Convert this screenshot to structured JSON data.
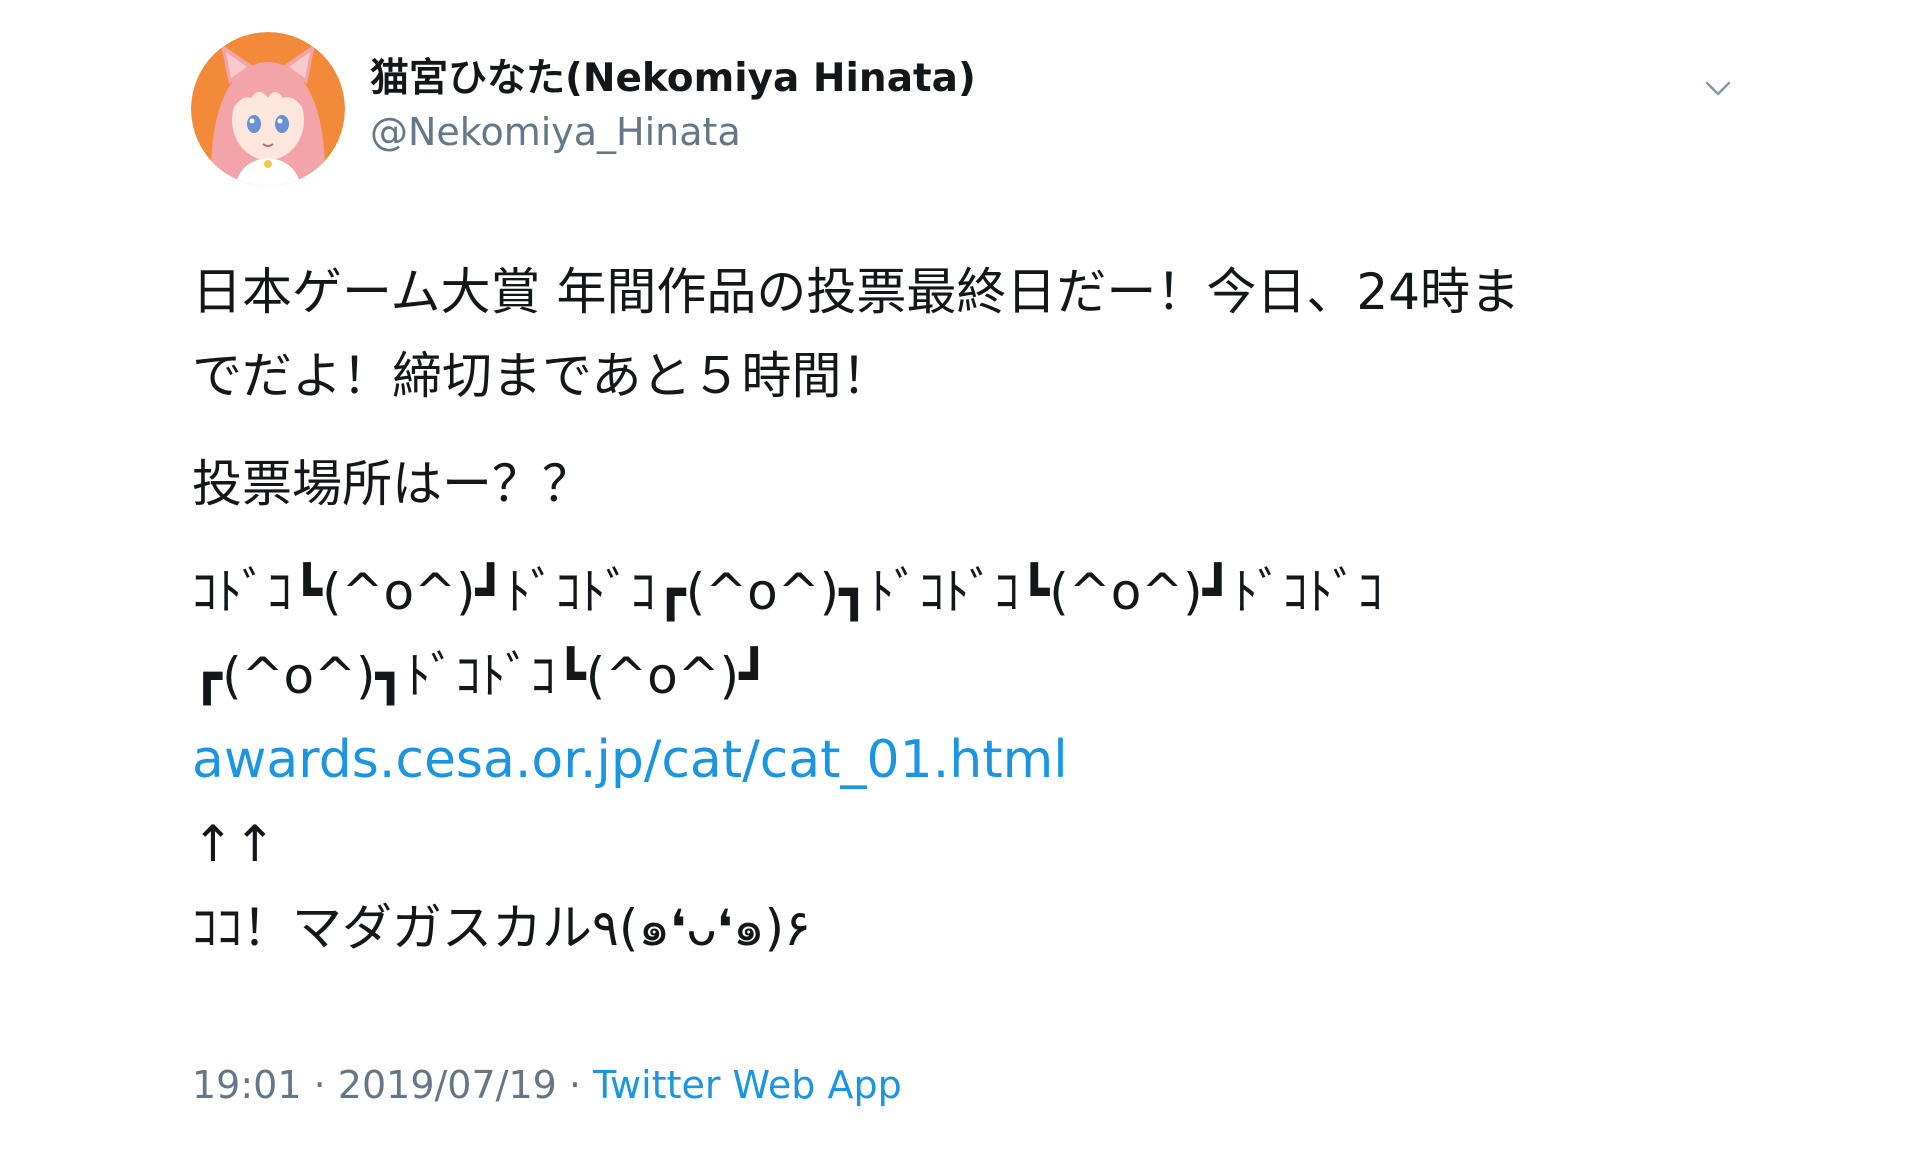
{
  "tweet": {
    "author": {
      "display_name": "猫宮ひなた(Nekomiya Hinata)",
      "handle": "@Nekomiya_Hinata"
    },
    "menu_icon": "chevron-down-icon",
    "text": {
      "line1": "日本ゲーム大賞 年間作品の投票最終日だー！今日、24時ま",
      "line2": "でだよ！締切まであと５時間！",
      "line3": "投票場所はー？？",
      "line4": "ｺﾄﾞｺ┗(^o^)┛ﾄﾞｺﾄﾞｺ┏(^o^)┓ﾄﾞｺﾄﾞｺ┗(^o^)┛ﾄﾞｺﾄﾞｺ",
      "line5": "┏(^o^)┓ﾄﾞｺﾄﾞｺ┗(^o^)┛",
      "link": "awards.cesa.or.jp/cat/cat_01.html",
      "arrows": "↑↑",
      "line6": "ｺｺ！マダガスカル٩(๑❛ᴗ❛๑)۶"
    },
    "meta": {
      "time": "19:01",
      "separator": "·",
      "date": "2019/07/19",
      "source": "Twitter Web App"
    },
    "colors": {
      "link": "#1b95e0",
      "secondary_text": "#657786",
      "primary_text": "#14171a",
      "avatar_bg": "#f28a3a"
    }
  }
}
